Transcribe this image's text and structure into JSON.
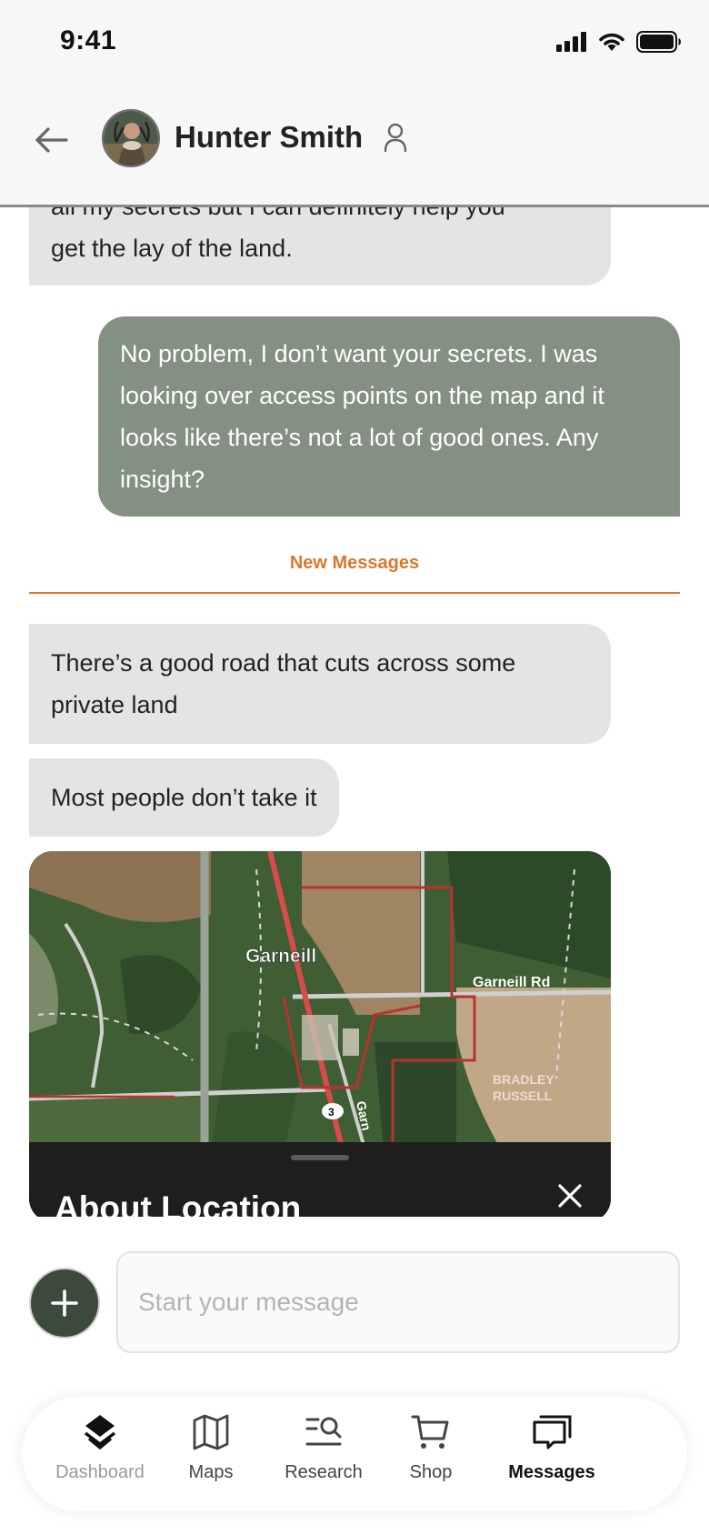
{
  "status_bar": {
    "time": "9:41"
  },
  "header": {
    "contact_name": "Hunter Smith"
  },
  "chat": {
    "partial_message": [
      "all my secrets but I can definitely help you",
      "get the lay of the land."
    ],
    "outgoing_message": [
      "No problem, I don’t want your secrets. I was",
      "looking over access points on the map and it",
      "looks like there’s not a lot of good ones. Any",
      "insight?"
    ],
    "new_messages_label": "New Messages",
    "incoming_1": [
      "There’s a good road that cuts across some",
      "private land"
    ],
    "incoming_2": "Most people don’t take it",
    "map": {
      "town_label": "Garneill",
      "road_label": "Garneill Rd",
      "owner_label_line1": "BRADLEY",
      "owner_label_line2": "RUSSELL",
      "route_shield": "3",
      "vertical_road_label": "Garn",
      "panel_title": "About Location"
    }
  },
  "composer": {
    "placeholder": "Start your message"
  },
  "nav": {
    "items": [
      {
        "label": "Dashboard",
        "icon": "layers-icon"
      },
      {
        "label": "Maps",
        "icon": "map-icon"
      },
      {
        "label": "Research",
        "icon": "research-icon"
      },
      {
        "label": "Shop",
        "icon": "cart-icon"
      },
      {
        "label": "Messages",
        "icon": "messages-icon"
      }
    ],
    "active": "Messages"
  },
  "colors": {
    "accent_orange": "#d9782c",
    "outgoing_bubble": "#849082",
    "incoming_bubble": "#e4e4e4",
    "add_button": "#3b4a3b"
  }
}
